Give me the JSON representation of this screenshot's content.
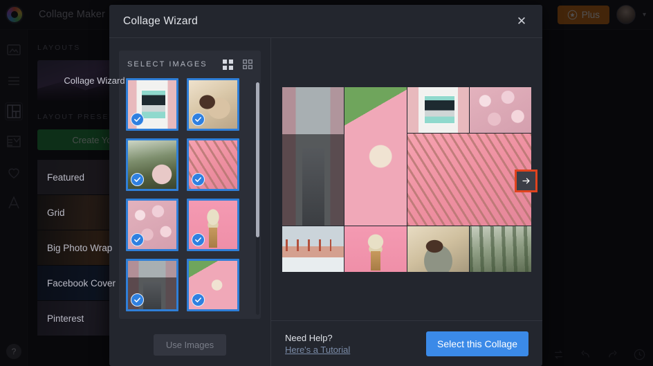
{
  "app": {
    "title": "Collage Maker",
    "title_chevron": "chevron-down-icon",
    "plus_label": "Plus",
    "avatar_chevron": "chevron-down-icon",
    "help_label": "?",
    "rail_items": [
      {
        "name": "photos",
        "icon": "image-icon"
      },
      {
        "name": "effects",
        "icon": "sliders-icon"
      },
      {
        "name": "collage",
        "icon": "collage-grid-icon",
        "active": true
      },
      {
        "name": "layers",
        "icon": "layers-icon"
      },
      {
        "name": "favorites",
        "icon": "heart-icon"
      },
      {
        "name": "text",
        "icon": "text-a-icon"
      }
    ],
    "bottom_tools": [
      {
        "name": "replace",
        "icon": "swap-icon"
      },
      {
        "name": "undo",
        "icon": "undo-arrow-icon"
      },
      {
        "name": "redo",
        "icon": "redo-arrow-icon"
      },
      {
        "name": "history",
        "icon": "clock-icon"
      }
    ]
  },
  "sidebar": {
    "layouts_label": "LAYOUTS",
    "wizard_card_label": "Collage Wizard",
    "presets_label": "LAYOUT PRESETS",
    "create_button_label": "Create You",
    "presets": [
      {
        "label": "Featured"
      },
      {
        "label": "Grid"
      },
      {
        "label": "Big Photo Wrap"
      },
      {
        "label": "Facebook Cover"
      },
      {
        "label": "Pinterest"
      }
    ]
  },
  "modal": {
    "title": "Collage Wizard",
    "close_icon": "close-icon",
    "picker": {
      "title": "SELECT IMAGES",
      "view_toggles": [
        {
          "name": "grid-large-view",
          "icon": "grid-large-icon",
          "active": true
        },
        {
          "name": "grid-small-view",
          "icon": "grid-small-icon",
          "active": false
        }
      ],
      "thumbnails": [
        {
          "alt": "pink-building-window",
          "art": "ph-window",
          "selected": true
        },
        {
          "alt": "woman-in-dry-flowers",
          "art": "ph-woman",
          "selected": true
        },
        {
          "alt": "woman-by-green-wall",
          "art": "ph-green",
          "selected": true
        },
        {
          "alt": "palm-leaves-on-pink",
          "art": "ph-palm",
          "selected": true
        },
        {
          "alt": "pink-peonies",
          "art": "ph-flowers",
          "selected": true
        },
        {
          "alt": "ice-cream-cone-on-pink",
          "art": "ph-icecream",
          "selected": true
        },
        {
          "alt": "pink-street-cars",
          "art": "ph-street",
          "selected": true
        },
        {
          "alt": "latte-on-pink-desk",
          "art": "ph-coffee",
          "selected": true
        }
      ],
      "use_images_label": "Use Images",
      "use_images_disabled": true
    },
    "preview": {
      "next_button_icon": "arrow-right-icon",
      "next_button_highlight_color": "#e0431e",
      "cells": [
        {
          "alt": "pink-street-cars",
          "art": "ph-street",
          "col": "1 / 2",
          "row": "1 / 4"
        },
        {
          "alt": "latte-on-pink-desk",
          "art": "ph-coffee",
          "col": "2 / 3",
          "row": "1 / 4"
        },
        {
          "alt": "pink-building-window",
          "art": "ph-window",
          "col": "3 / 4",
          "row": "1 / 2"
        },
        {
          "alt": "pink-peonies",
          "art": "ph-flowers",
          "col": "4 / 5",
          "row": "1 / 2"
        },
        {
          "alt": "palm-leaves-on-pink",
          "art": "ph-palm",
          "col": "3 / 5",
          "row": "2 / 4"
        },
        {
          "alt": "golden-gate-bridge",
          "art": "ph-bridge",
          "col": "1 / 2",
          "row": "4 / 5"
        },
        {
          "alt": "ice-cream-cone-on-pink",
          "art": "ph-icecream",
          "col": "2 / 3",
          "row": "4 / 5"
        },
        {
          "alt": "woman-in-dry-flowers",
          "art": "ph-portrait",
          "col": "3 / 4",
          "row": "4 / 5"
        },
        {
          "alt": "woman-by-green-wall",
          "art": "ph-vines",
          "col": "4 / 5",
          "row": "4 / 5"
        }
      ]
    },
    "footer": {
      "need_help": "Need Help?",
      "tutorial_link": "Here's a Tutorial",
      "select_button_label": "Select this Collage"
    }
  },
  "colors": {
    "accent_blue": "#3b8ae8",
    "selection_blue": "#2f7fd8",
    "plus_orange": "#d4700f",
    "highlight_red": "#e0431e",
    "create_green": "#1f8f3c"
  }
}
